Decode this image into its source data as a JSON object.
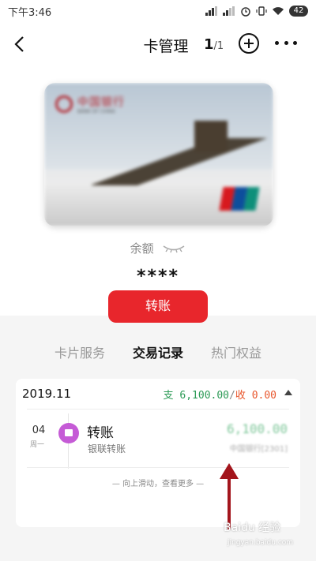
{
  "status_bar": {
    "time": "下午3:46",
    "battery": "42"
  },
  "nav": {
    "title": "卡管理",
    "page_current": "1",
    "page_total": "/1"
  },
  "card": {
    "bank_name": "中国银行",
    "bank_sub": "BANK OF CHINA",
    "unionpay_colors": [
      "#d7191e",
      "#0d4e9c",
      "#0e8f7a"
    ]
  },
  "balance": {
    "label": "余额",
    "value": "****",
    "eye_icon": "eye-closed-icon"
  },
  "actions": {
    "transfer_label": "转账"
  },
  "tabs": [
    {
      "label": "卡片服务"
    },
    {
      "label": "交易记录",
      "active": true
    },
    {
      "label": "热门权益"
    }
  ],
  "transactions": {
    "month": "2019.11",
    "expense_prefix": "支",
    "expense": "6,100.00",
    "income_prefix": "收",
    "income": "0.00",
    "items": [
      {
        "day": "04",
        "weekday": "周一",
        "title": "转账",
        "subtitle": "银联转账",
        "amount": "6,100.00",
        "account": "中国银行[2301]"
      }
    ],
    "scroll_hint": "— 向上滑动，查看更多 —"
  },
  "watermark": {
    "text": "Baidu 经验",
    "sub": "jingyan.baidu.com"
  },
  "colors": {
    "accent": "#e8262c",
    "expense": "#2c9a56",
    "income": "#e8562c",
    "arrow": "#a3151c"
  }
}
